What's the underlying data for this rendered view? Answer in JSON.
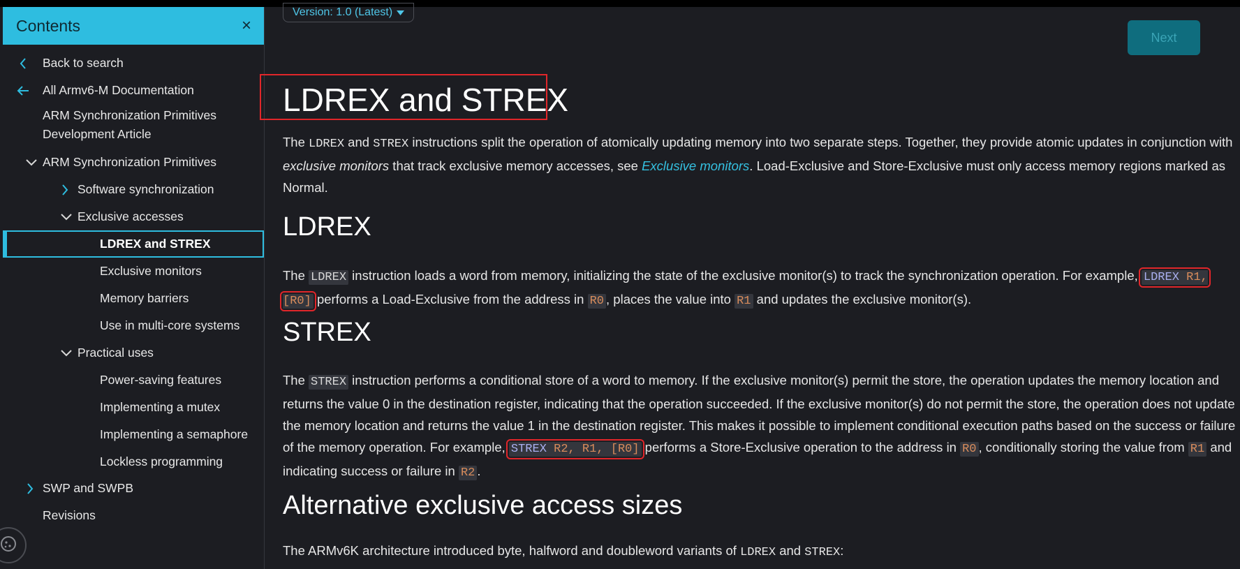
{
  "sidebar": {
    "title": "Contents",
    "close_icon": "×",
    "items": [
      {
        "label": "Back to search",
        "icon": "chevron-left-icon"
      },
      {
        "label": "All Armv6-M Documentation",
        "icon": "arrow-left-icon"
      },
      {
        "label": "ARM Synchronization Primitives Development Article"
      },
      {
        "label": "ARM Synchronization Primitives",
        "icon": "chevron-down-icon"
      },
      {
        "label": "Software synchronization",
        "icon": "chevron-right-icon"
      },
      {
        "label": "Exclusive accesses",
        "icon": "chevron-down-icon"
      },
      {
        "label": "LDREX and STREX",
        "active": true
      },
      {
        "label": "Exclusive monitors"
      },
      {
        "label": "Memory barriers"
      },
      {
        "label": "Use in multi-core systems"
      },
      {
        "label": "Practical uses",
        "icon": "chevron-down-icon"
      },
      {
        "label": "Power-saving features"
      },
      {
        "label": "Implementing a mutex"
      },
      {
        "label": "Implementing a semaphore"
      },
      {
        "label": "Lockless programming"
      },
      {
        "label": "SWP and SWPB",
        "icon": "chevron-right-icon"
      },
      {
        "label": "Revisions"
      }
    ]
  },
  "toolbar": {
    "version_label": "Version: 1.0 (Latest)",
    "next_label": "Next"
  },
  "article": {
    "title": "LDREX and STREX",
    "intro": {
      "p1": "The ",
      "c1": "LDREX",
      "p2": " and ",
      "c2": "STREX",
      "p3": " instructions split the operation of atomically updating memory into two separate steps. Together, they provide atomic updates in conjunction with ",
      "em": "exclusive monitors",
      "p4": " that track exclusive memory accesses, see ",
      "link": "Exclusive monitors",
      "p5": ". Load-Exclusive and Store-Exclusive must only access memory regions marked as Normal."
    },
    "ldrex": {
      "heading": "LDREX",
      "p1": "The ",
      "c1": "LDREX",
      "p2": " instruction loads a word from memory, initializing the state of the exclusive monitor(s) to track the synchronization operation. For example, ",
      "ex_kw": "LDREX",
      "ex_args": " R1, [R0]",
      "p3": " performs a Load-Exclusive from the address in ",
      "r0": "R0",
      "p4": ", places the value into ",
      "r1": "R1",
      "p5": " and updates the exclusive monitor(s)."
    },
    "strex": {
      "heading": "STREX",
      "p1": "The ",
      "c1": "STREX",
      "p2": " instruction performs a conditional store of a word to memory. If the exclusive monitor(s) permit the store, the operation updates the memory location and returns the value 0 in the destination register, indicating that the operation succeeded. If the exclusive monitor(s) do not permit the store, the operation does not update the memory location and returns the value 1 in the destination register. This makes it possible to implement conditional execution paths based on the success or failure of the memory operation. For example, ",
      "ex_kw": "STREX",
      "ex_args": " R2, R1, [R0]",
      "p3": " performs a Store-Exclusive operation to the address in ",
      "r0": "R0",
      "p4": ", conditionally storing the value from ",
      "r1": "R1",
      "p5": " and indicating success or failure in ",
      "r2": "R2",
      "p6": "."
    },
    "alt": {
      "heading": "Alternative exclusive access sizes",
      "p1": "The ARMv6K architecture introduced byte, halfword and doubleword variants of ",
      "c1": "LDREX",
      "p2": " and ",
      "c2": "STREX",
      "p3": ":"
    }
  }
}
